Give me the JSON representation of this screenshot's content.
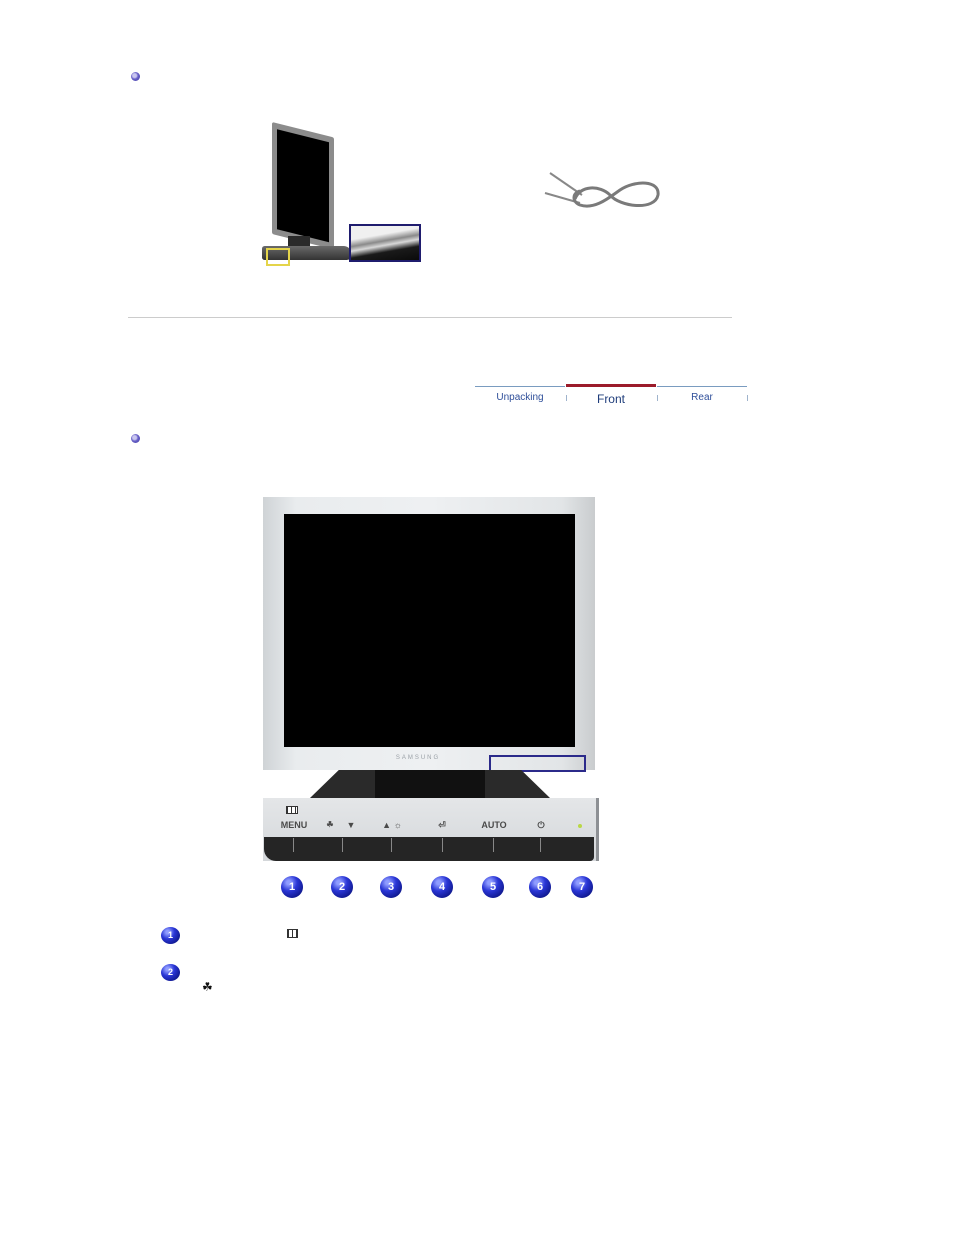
{
  "section_bullets": [
    "bullet-1",
    "bullet-2"
  ],
  "unpacking_images": {
    "monitor_side_view": "monitor-side-view-image",
    "cable": "audio-cable-image"
  },
  "tabs": [
    {
      "label": "Unpacking",
      "active": false
    },
    {
      "label": "Front",
      "active": true
    },
    {
      "label": "Rear",
      "active": false
    }
  ],
  "front_view": {
    "brand_logo": "SAMSUNG",
    "controls": [
      {
        "number": "1",
        "label": "MENU",
        "icon": "menu-icon"
      },
      {
        "number": "2",
        "label": "▼",
        "icon": "magic-bright-icon"
      },
      {
        "number": "3",
        "label": "▲ ☼",
        "icon": "brightness-icon"
      },
      {
        "number": "4",
        "label": "⏎",
        "icon": "enter-icon"
      },
      {
        "number": "5",
        "label": "AUTO",
        "icon": ""
      },
      {
        "number": "6",
        "label": "⏻",
        "icon": "power-icon"
      },
      {
        "number": "7",
        "label": "",
        "icon": "power-indicator-led"
      }
    ]
  },
  "descriptions": [
    {
      "number": "1",
      "icon": "menu-icon"
    },
    {
      "number": "2",
      "icon": "magic-bright-icon"
    }
  ],
  "colors": {
    "tab_active_bar": "#9b1b2a",
    "tab_text": "#2f4f9a",
    "bullet": "#5b54c0",
    "number_ball": "#1a24b0",
    "highlight_box": "#2b2a8a"
  }
}
